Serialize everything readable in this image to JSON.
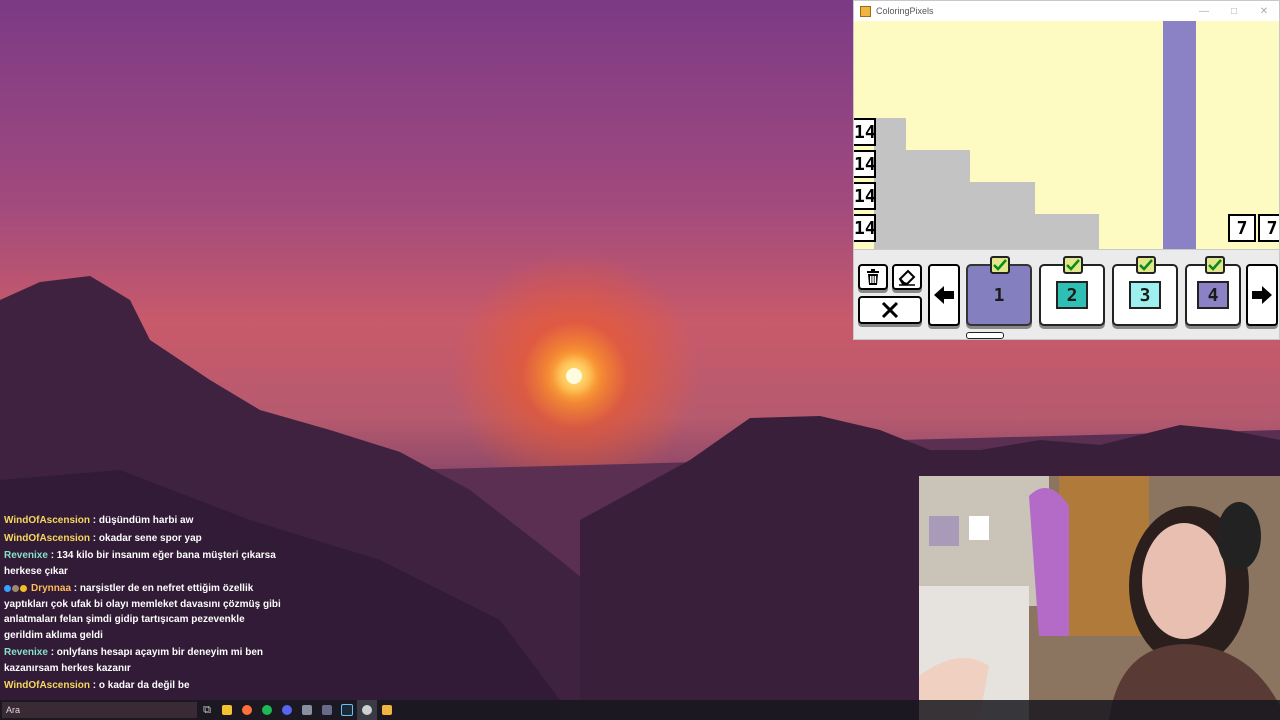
{
  "app": {
    "title": "ColoringPixels",
    "window_controls": [
      "—",
      "□",
      "✕"
    ],
    "row_clues": [
      "14",
      "14",
      "14",
      "14"
    ],
    "col_clues": [
      "7",
      "7"
    ],
    "palette": [
      {
        "number": "1",
        "color": "#8480c0",
        "selected": true,
        "completed": true
      },
      {
        "number": "2",
        "color": "#2fbfb4",
        "selected": false,
        "completed": true
      },
      {
        "number": "3",
        "color": "#9ef0ee",
        "selected": false,
        "completed": true
      },
      {
        "number": "4",
        "color": "#8a82c4",
        "selected": false,
        "completed": true
      }
    ],
    "tools": [
      "trash-icon",
      "eraser-icon",
      "close-icon",
      "arrow-left-icon",
      "arrow-right-icon"
    ]
  },
  "chat": {
    "messages": [
      {
        "user": "WindOfAscension",
        "text": " : düşündüm harbi aw",
        "color": "#f6d860"
      },
      {
        "user": "WindOfAscension",
        "text": " : okadar sene spor yap",
        "color": "#f6d860"
      },
      {
        "user": "Revenixe",
        "text": " : 134 kilo bir insanım eğer bana müşteri çıkarsa herkese çıkar",
        "color": "#88e0c8"
      },
      {
        "user": "Drynnaa",
        "text": " : narşistler de en nefret ettiğim özellik yaptıkları çok ufak bi olayı memleket davasını çözmüş gibi anlatmaları felan şimdi gidip tartışıcam pezevenkle gerildim aklıma geldi",
        "color": "#ffbe5a",
        "badges": true
      },
      {
        "user": "Revenixe",
        "text": " : onlyfans hesapı açayım bir deneyim mi ben kazanırsam herkes kazanır",
        "color": "#88e0c8"
      },
      {
        "user": "WindOfAscension",
        "text": " : o kadar da değil be",
        "color": "#f6d860"
      }
    ]
  },
  "taskbar": {
    "search_text": "Ara"
  }
}
